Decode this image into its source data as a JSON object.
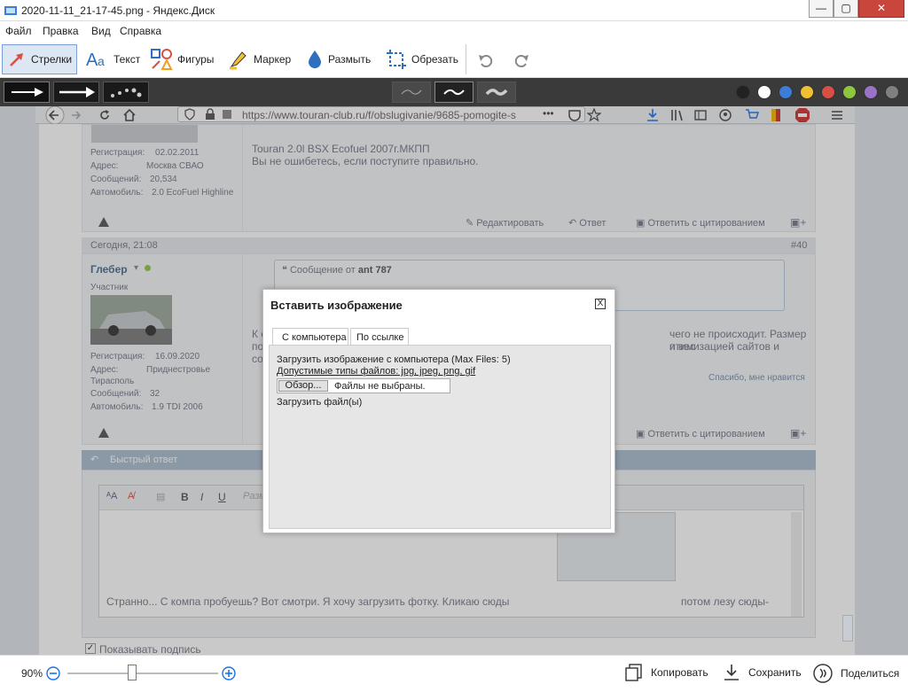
{
  "window": {
    "title": "2020-11-11_21-17-45.png - Яндекс.Диск",
    "minimize": "—",
    "maximize": "▢",
    "close": "✕"
  },
  "menu": [
    "Файл",
    "Правка",
    "Вид",
    "Справка"
  ],
  "toolbar": {
    "tools": [
      {
        "label": "Стрелки",
        "icon": "arrow-tool-icon",
        "active": true
      },
      {
        "label": "Текст",
        "icon": "text-tool-icon",
        "active": false
      },
      {
        "label": "Фигуры",
        "icon": "shapes-tool-icon",
        "active": false
      },
      {
        "label": "Маркер",
        "icon": "marker-tool-icon",
        "active": false
      },
      {
        "label": "Размыть",
        "icon": "blur-tool-icon",
        "active": false
      },
      {
        "label": "Обрезать",
        "icon": "crop-tool-icon",
        "active": false
      }
    ]
  },
  "palette": [
    "#222222",
    "#ffffff",
    "#3b7dd8",
    "#f0c030",
    "#d94f44",
    "#8ec63f",
    "#9b72c8",
    "#808080"
  ],
  "browser": {
    "url": "https://www.touran-club.ru/f/obslugivanie/9685-pomogite-s"
  },
  "post1": {
    "reg_label": "Регистрация:",
    "reg": "02.02.2011",
    "addr_label": "Адрес:",
    "addr": "Москва СВАО",
    "msgs_label": "Сообщений:",
    "msgs": "20,534",
    "car_label": "Автомобиль:",
    "car": "2.0 EcoFuel Highline",
    "text1": "Touran 2.0l BSX Ecofuel 2007г.МКПП",
    "text2": "Вы не ошибетесь, если поступите правильно.",
    "edit": "Редактировать",
    "reply": "Ответ",
    "quote": "Ответить с цитированием"
  },
  "post2": {
    "date": "Сегодня, 21:08",
    "num": "#40",
    "user": "Глебер",
    "role": "Участник",
    "quote_from": "Сообщение от",
    "quote_author": "ant 787",
    "reg_label": "Регистрация:",
    "reg": "16.09.2020",
    "addr_label": "Адрес:",
    "addr": "Приднестровье",
    "addr2": "Тирасполь",
    "msgs_label": "Сообщений:",
    "msgs": "32",
    "car_label": "Автомобиль:",
    "car": "1.9 TDI 2006",
    "text_a": "К с",
    "text_b": "по",
    "text_c": "со",
    "text_r1": "чего не происходит. Размер и вес",
    "text_r2": "птимизацией сайтов и",
    "thanks": "Спасибо, мне нравится",
    "quote": "Ответить с цитированием"
  },
  "quick_reply": {
    "title": "Быстрый ответ",
    "placeholder": "Разм",
    "text": "Странно... С компа пробуешь? Вот смотри. Я хочу загрузить фотку. Кликаю сюды",
    "text2": "потом лезу сюды-",
    "show_sig": "Показывать подпись"
  },
  "modal": {
    "title": "Вставить изображение",
    "close": "X",
    "tab1": "С компьютера",
    "tab2": "По ссылке",
    "line1": "Загрузить изображение с компьютера (Max Files: 5)",
    "line2": "Допустимые типы файлов: jpg, jpeg, png, gif",
    "browse": "Обзор...",
    "no_files": "Файлы не выбраны.",
    "upload": "Загрузить файл(ы)"
  },
  "bottom": {
    "zoom": "90%",
    "copy": "Копировать",
    "save": "Сохранить",
    "share": "Поделиться"
  }
}
